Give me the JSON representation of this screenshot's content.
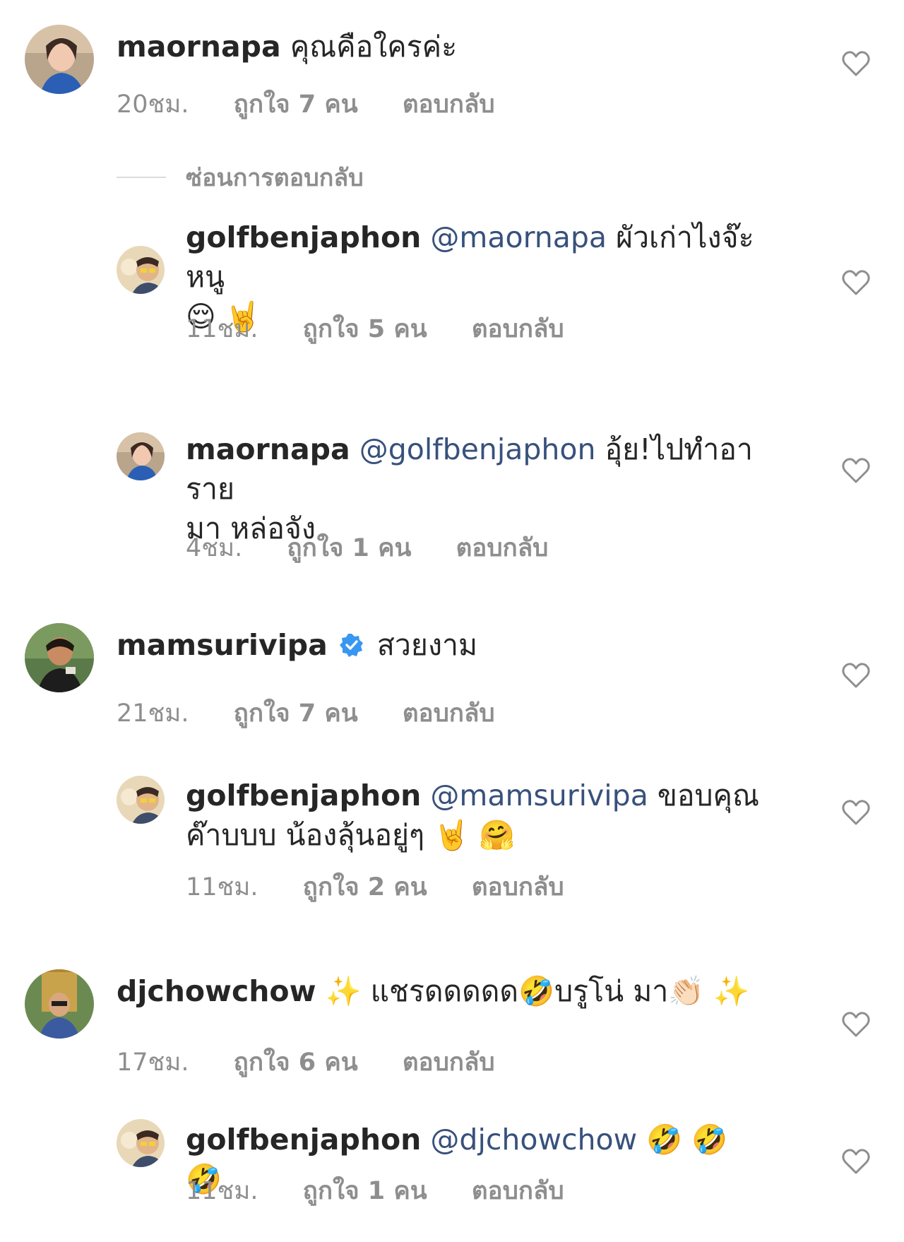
{
  "hide_replies_label": "ซ่อนการตอบกลับ",
  "colors": {
    "text": "#262626",
    "meta": "#8e8e8e",
    "mention": "#38517c",
    "verified": "#3897f0"
  },
  "comments": [
    {
      "username": "maornapa",
      "text": "คุณคือใครค่ะ",
      "time": "20ชม.",
      "likes": "ถูกใจ 7 คน",
      "reply": "ตอบกลับ"
    },
    {
      "username": "golfbenjaphon",
      "mention": "@maornapa",
      "text_line1": "ผัวเก่าไงจ๊ะหนู",
      "emoji_line2": "😌 🤘",
      "time": "11ชม.",
      "likes": "ถูกใจ 5 คน",
      "reply": "ตอบกลับ"
    },
    {
      "username": "maornapa",
      "mention": "@golfbenjaphon",
      "text_line1": "อุ้ย!ไปทำอาราย",
      "text_line2": "มา หล่อจัง",
      "time": "4ชม.",
      "likes": "ถูกใจ 1 คน",
      "reply": "ตอบกลับ"
    },
    {
      "username": "mamsurivipa",
      "verified_icon": "verified-badge-icon",
      "text": "สวยงาม",
      "time": "21ชม.",
      "likes": "ถูกใจ 7 คน",
      "reply": "ตอบกลับ"
    },
    {
      "username": "golfbenjaphon",
      "mention": "@mamsurivipa",
      "text_line1": "ขอบคุณ",
      "text_line2": "ค๊าบบบ น้องลุ้นอยู่ๆ",
      "emoji_line2": "🤘 🤗",
      "time": "11ชม.",
      "likes": "ถูกใจ 2 คน",
      "reply": "ตอบกลับ"
    },
    {
      "username": "djchowchow",
      "text_part1": "✨ แชรดดดดด",
      "emoji_mid": "🤣",
      "text_part2": "บรูโน่ มา",
      "emoji_end": "👏🏻 ✨",
      "time": "17ชม.",
      "likes": "ถูกใจ 6 คน",
      "reply": "ตอบกลับ"
    },
    {
      "username": "golfbenjaphon",
      "mention": "@djchowchow",
      "emoji_line1": "🤣 🤣 🤣",
      "time": "11ชม.",
      "likes": "ถูกใจ 1 คน",
      "reply": "ตอบกลับ"
    }
  ]
}
